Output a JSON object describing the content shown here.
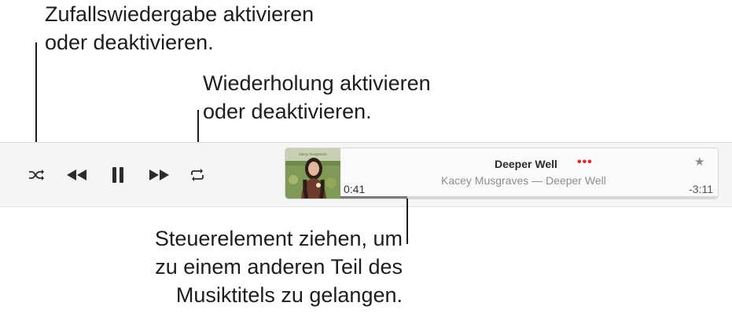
{
  "callouts": {
    "shuffle": [
      "Zufallswiedergabe aktivieren",
      "oder deaktivieren."
    ],
    "repeat": [
      "Wiederholung aktivieren",
      "oder deaktivieren."
    ],
    "scrubber": [
      "Steuerelement ziehen, um",
      "zu einem anderen Teil des",
      "Musiktitels zu gelangen."
    ]
  },
  "controls": {
    "shuffle_icon": "shuffle-icon",
    "previous_icon": "backward-icon",
    "pause_icon": "pause-icon",
    "next_icon": "forward-icon",
    "repeat_icon": "repeat-icon"
  },
  "now_playing": {
    "title": "Deeper Well",
    "more": "•••",
    "favorite_icon": "★",
    "subtitle": "Kacey Musgraves — Deeper Well",
    "elapsed": "0:41",
    "remaining": "-3:11",
    "progress_fraction": 0.177
  },
  "colors": {
    "accent": "#e8242c",
    "toolbar_bg": "#f5f5f5"
  }
}
